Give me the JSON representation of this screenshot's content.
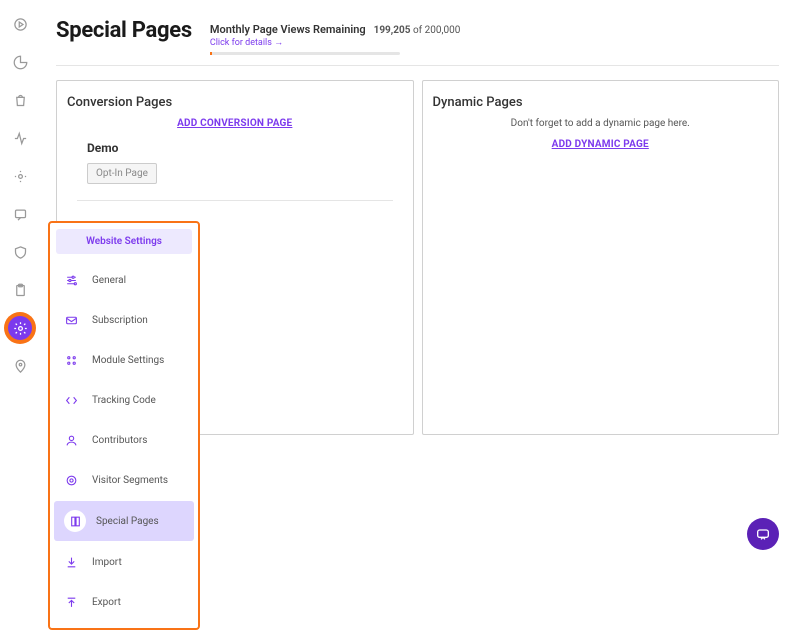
{
  "header": {
    "title": "Special Pages",
    "quota": {
      "label": "Monthly Page Views Remaining",
      "used": "199,205",
      "of_word": "of",
      "total": "200,000",
      "details_link": "Click for details →"
    }
  },
  "cards": {
    "conversion": {
      "title": "Conversion Pages",
      "add_label": "ADD CONVERSION PAGE",
      "items": [
        {
          "name": "Demo",
          "tag": "Opt-In Page"
        }
      ]
    },
    "dynamic": {
      "title": "Dynamic Pages",
      "empty_text": "Don't forget to add a dynamic page here.",
      "add_label": "ADD DYNAMIC PAGE"
    }
  },
  "popup": {
    "title": "Website Settings",
    "items": [
      {
        "icon": "sliders-icon",
        "label": "General"
      },
      {
        "icon": "mail-icon",
        "label": "Subscription"
      },
      {
        "icon": "grid-icon",
        "label": "Module Settings"
      },
      {
        "icon": "code-icon",
        "label": "Tracking Code"
      },
      {
        "icon": "user-icon",
        "label": "Contributors"
      },
      {
        "icon": "target-icon",
        "label": "Visitor Segments"
      },
      {
        "icon": "pages-icon",
        "label": "Special Pages",
        "selected": true
      },
      {
        "icon": "download-icon",
        "label": "Import"
      },
      {
        "icon": "upload-icon",
        "label": "Export"
      }
    ]
  },
  "rail_icons": [
    "play-icon",
    "pie-icon",
    "bag-icon",
    "activity-icon",
    "focus-icon",
    "chat-icon",
    "shield-icon",
    "clipboard-icon",
    "gear-icon",
    "pin-icon"
  ]
}
